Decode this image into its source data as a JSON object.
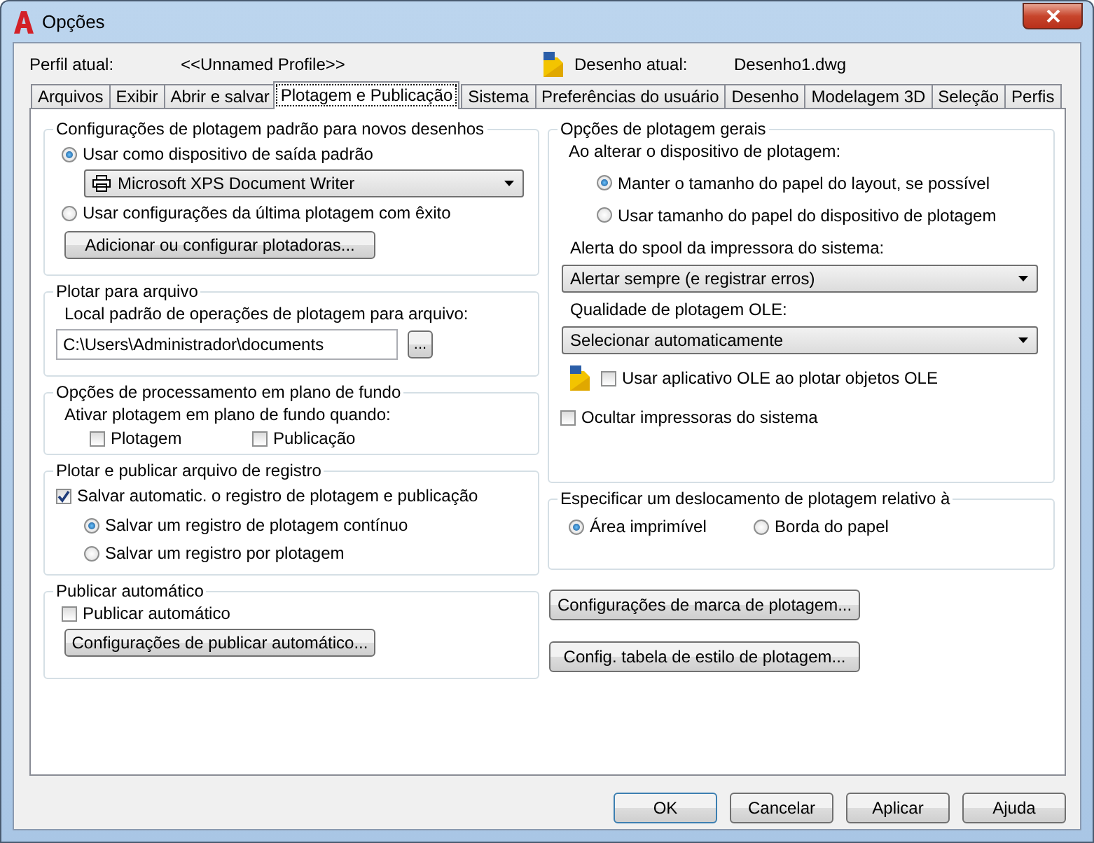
{
  "window": {
    "title": "Opções"
  },
  "profile": {
    "label": "Perfil atual:",
    "value": "<<Unnamed Profile>>"
  },
  "drawing": {
    "label": "Desenho atual:",
    "value": "Desenho1.dwg"
  },
  "tabs": [
    {
      "label": "Arquivos",
      "selected": false
    },
    {
      "label": "Exibir",
      "selected": false
    },
    {
      "label": "Abrir e salvar",
      "selected": false
    },
    {
      "label": "Plotagem e Publicação",
      "selected": true
    },
    {
      "label": "Sistema",
      "selected": false
    },
    {
      "label": "Preferências do usuário",
      "selected": false
    },
    {
      "label": "Desenho",
      "selected": false
    },
    {
      "label": "Modelagem 3D",
      "selected": false
    },
    {
      "label": "Seleção",
      "selected": false
    },
    {
      "label": "Perfis",
      "selected": false
    }
  ],
  "default_settings": {
    "title": "Configurações de plotagem padrão para novos desenhos",
    "use_default": {
      "label": "Usar como dispositivo de saída padrão",
      "selected": true
    },
    "device": "Microsoft XPS Document Writer",
    "use_last": {
      "label": "Usar configurações da última plotagem com êxito",
      "selected": false
    },
    "button": "Adicionar ou configurar plotadoras..."
  },
  "plot_to_file": {
    "title": "Plotar para arquivo",
    "label": "Local padrão de operações de plotagem para arquivo:",
    "path": "C:\\Users\\Administrador\\documents",
    "browse": "..."
  },
  "background": {
    "title": "Opções de processamento em plano de fundo",
    "label": "Ativar plotagem em plano de fundo quando:",
    "options": [
      {
        "label": "Plotagem",
        "checked": false
      },
      {
        "label": "Publicação",
        "checked": false
      }
    ]
  },
  "log": {
    "title": "Plotar e publicar arquivo de registro",
    "autosave": {
      "label": "Salvar automatic. o registro de plotagem e publicação",
      "checked": true
    },
    "modes": [
      {
        "label": "Salvar um registro de plotagem contínuo",
        "selected": true
      },
      {
        "label": "Salvar um registro por plotagem",
        "selected": false
      }
    ]
  },
  "autopublish": {
    "title": "Publicar automático",
    "checkbox": {
      "label": "Publicar automático",
      "checked": false
    },
    "button": "Configurações de publicar automático..."
  },
  "general": {
    "title": "Opções de plotagem gerais",
    "device_change_label": "Ao alterar o dispositivo de plotagem:",
    "device_change": [
      {
        "label": "Manter o tamanho do papel do layout, se possível",
        "selected": true
      },
      {
        "label": "Usar tamanho do papel do dispositivo de plotagem",
        "selected": false
      }
    ],
    "spool_label": "Alerta do spool da impressora do sistema:",
    "spool": "Alertar sempre (e registrar erros)",
    "ole_label": "Qualidade de plotagem OLE:",
    "ole": "Selecionar automaticamente",
    "use_ole": {
      "label": "Usar aplicativo OLE ao plotar objetos OLE",
      "checked": false
    },
    "hide_printers": {
      "label": "Ocultar impressoras do sistema",
      "checked": false
    }
  },
  "offset": {
    "title": "Especificar um deslocamento de plotagem relativo à",
    "options": [
      {
        "label": "Área imprimível",
        "selected": true
      },
      {
        "label": "Borda do papel",
        "selected": false
      }
    ]
  },
  "stamp_button": "Configurações de marca de plotagem...",
  "style_button": "Config. tabela de estilo de plotagem...",
  "buttons": [
    "OK",
    "Cancelar",
    "Aplicar",
    "Ajuda"
  ]
}
